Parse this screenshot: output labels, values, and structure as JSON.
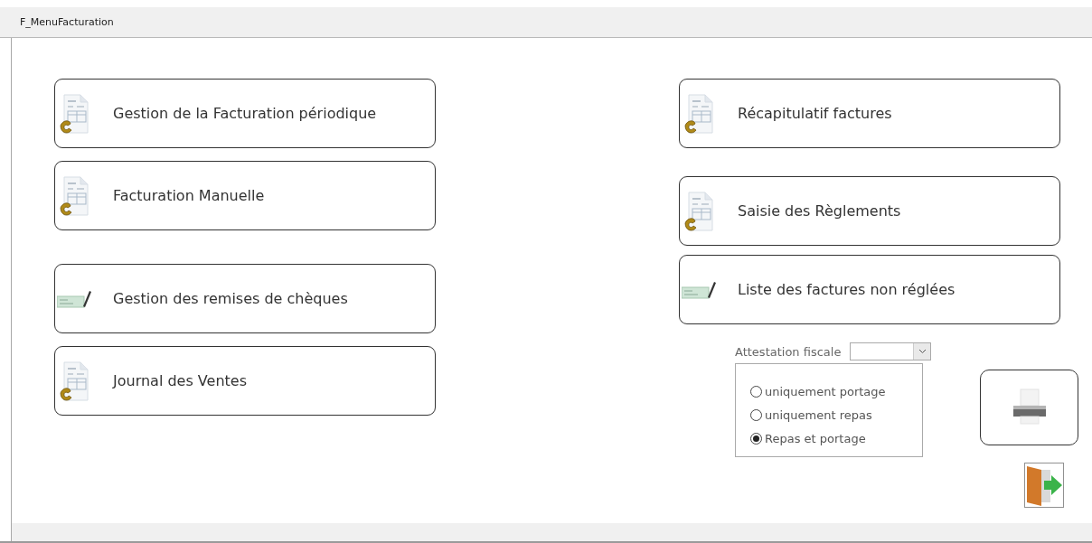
{
  "window": {
    "title": "F_MenuFacturation"
  },
  "left_buttons": [
    {
      "label": "Gestion de la Facturation périodique",
      "kind": "invoice"
    },
    {
      "label": "Facturation Manuelle",
      "kind": "invoice"
    },
    {
      "label": "Gestion des remises de chèques",
      "kind": "cheque"
    },
    {
      "label": "Journal des Ventes",
      "kind": "invoice"
    }
  ],
  "right_buttons": [
    {
      "label": "Récapitulatif factures",
      "kind": "invoice"
    },
    {
      "label": "Saisie des Règlements",
      "kind": "invoice"
    },
    {
      "label": "Liste des factures non réglées",
      "kind": "cheque"
    }
  ],
  "attestation": {
    "label": "Attestation fiscale",
    "options": [
      {
        "label": "uniquement portage",
        "selected": false
      },
      {
        "label": "uniquement repas",
        "selected": false
      },
      {
        "label": "Repas et portage",
        "selected": true
      }
    ]
  }
}
